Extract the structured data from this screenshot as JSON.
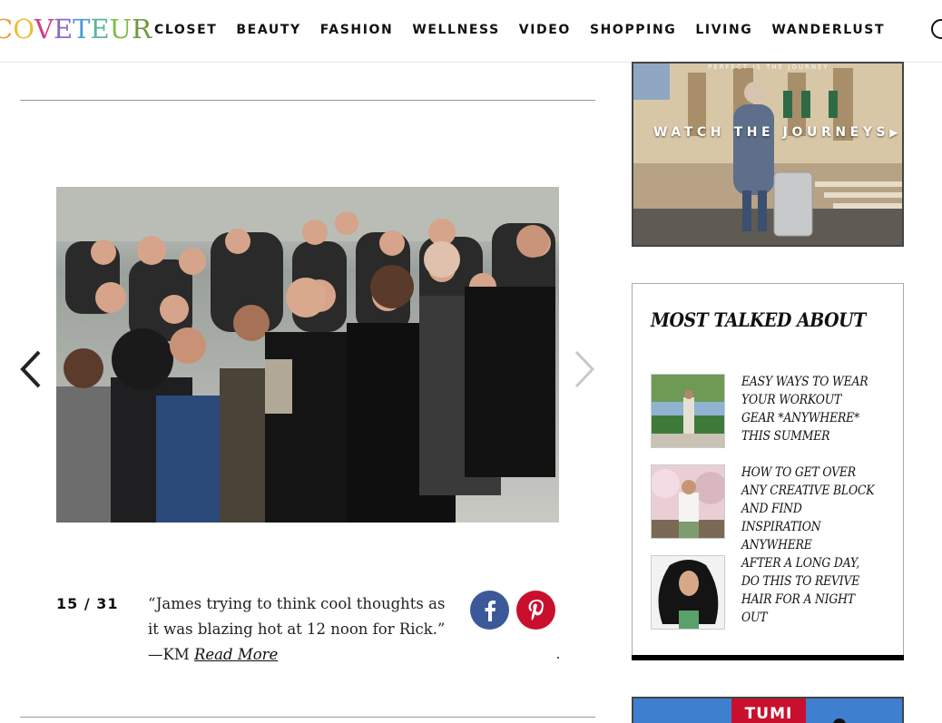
{
  "header": {
    "logo_letters": [
      "C",
      "O",
      "V",
      "E",
      "T",
      "E",
      "U",
      "R"
    ],
    "logo_colors": [
      "#e8a23b",
      "#e8c03b",
      "#cf3f84",
      "#8a6cc7",
      "#4a9bd6",
      "#5ab5a0",
      "#7cc04a",
      "#6e9a3b"
    ],
    "nav": [
      "CLOSET",
      "BEAUTY",
      "FASHION",
      "WELLNESS",
      "VIDEO",
      "SHOPPING",
      "LIVING",
      "WANDERLUST"
    ],
    "search_icon": "search-icon"
  },
  "slideshow": {
    "counter": "15 / 31",
    "caption": "“James trying to think cool thoughts as it was blazing hot at 12 noon for Rick.” —KM",
    "read_more": "Read More",
    "prev_icon": "chevron-left-icon",
    "next_icon": "chevron-right-icon"
  },
  "share": {
    "facebook_icon": "facebook-icon",
    "pinterest_icon": "pinterest-icon",
    "facebook_color": "#3b5998",
    "pinterest_color": "#c8102e"
  },
  "sidebar": {
    "ad_top": {
      "strip": "PERFECT IS THE JOURNEY",
      "cta": "WATCH THE JOURNEYS"
    },
    "most_talked": {
      "title": "MOST TALKED ABOUT",
      "items": [
        {
          "title": "Easy Ways to Wear Your Workout Gear *Anywhere* This Summer"
        },
        {
          "title": "How to Get Over Any Creative Block and Find Inspiration Anywhere"
        },
        {
          "title": "After a Long Day, Do This to Revive Hair for a Night Out"
        }
      ]
    },
    "ad_bottom": {
      "brand": "TUMI"
    }
  }
}
